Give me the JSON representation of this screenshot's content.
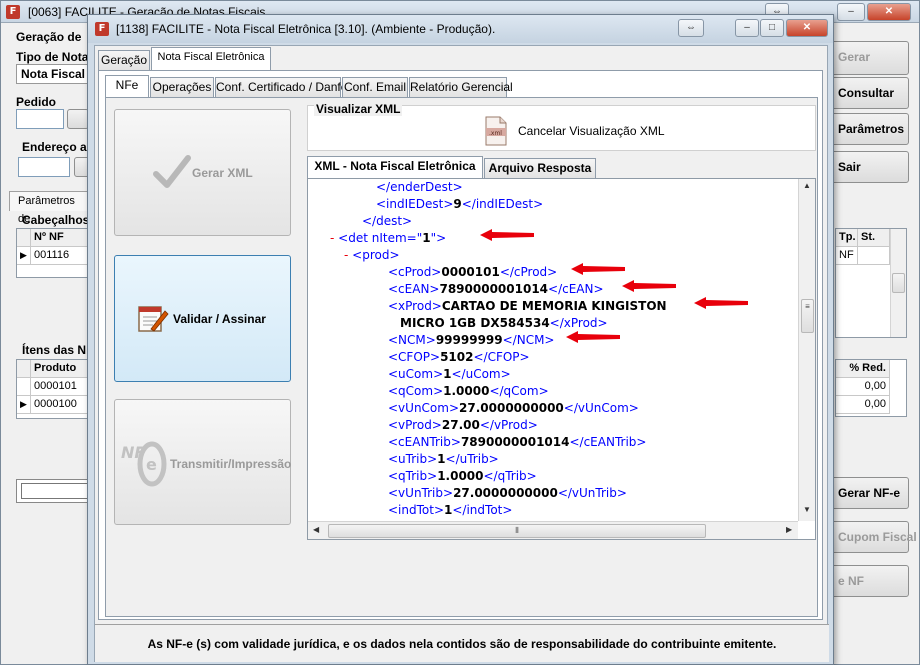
{
  "back_window": {
    "title": "[0063] FACILITE - Geração de Notas Fiscais",
    "labels": {
      "geracao_de": "Geração de",
      "tipo_de_nota": "Tipo de Nota",
      "nota_fiscal": "Nota Fiscal",
      "pedido": "Pedido",
      "endereco": "Endereço a",
      "parametros": "Parâmetros de",
      "cabecalhos": "Cabeçalhos",
      "itens": "Ítens das N"
    },
    "buttons": [
      "Gerar",
      "Consultar",
      "Parâmetros",
      "Sair",
      "Gerar NF-e",
      "Cupom Fiscal",
      "e NF"
    ],
    "header_grid": {
      "columns": [
        "Nº NF",
        "Tp.",
        "St."
      ],
      "rows": [
        {
          "nf": "001116",
          "tp": "NF",
          "st": ""
        }
      ]
    },
    "items_grid": {
      "columns": [
        "Produto",
        "% Red."
      ],
      "rows": [
        {
          "produto": "0000101",
          "red": "0,00"
        },
        {
          "produto": "0000100",
          "red": "0,00"
        }
      ]
    }
  },
  "dialog": {
    "title": "[1138] FACILITE - Nota Fiscal Eletrônica [3.10]. (Ambiente - Produção).",
    "top_tabs": [
      "Geração",
      "Nota Fiscal Eletrônica"
    ],
    "sub_tabs": [
      "NFe",
      "Operações",
      "Conf. Certificado / Danfe",
      "Conf. Email",
      "Relatório Gerencial"
    ],
    "buttons": {
      "gerar_xml": "Gerar XML",
      "validar": "Validar / Assinar",
      "transmitir": "Transmitir/Impressão"
    },
    "group_title": "Visualizar XML",
    "cancel_view": "Cancelar Visualização XML",
    "viewer_tabs": [
      "XML - Nota Fiscal Eletrônica",
      "Arquivo Resposta"
    ],
    "xml_lines": [
      {
        "tag": "</enderDest>"
      },
      {
        "open": "<indIEDest>",
        "val": "9",
        "close": "</indIEDest>"
      },
      {
        "tag": "</dest>"
      },
      {
        "mark": "-",
        "open": "<det nItem=\"",
        "val": "1",
        "close": "\">"
      },
      {
        "mark": "-",
        "tag": "<prod>"
      },
      {
        "open": "<cProd>",
        "val": "0000101",
        "close": "</cProd>"
      },
      {
        "open": "<cEAN>",
        "val": "7890000001014",
        "close": "</cEAN>"
      },
      {
        "open": "<xProd>",
        "val": "CARTAO DE MEMORIA KINGISTON"
      },
      {
        "val": "MICRO 1GB DX584534",
        "close": "</xProd>"
      },
      {
        "open": "<NCM>",
        "val": "99999999",
        "close": "</NCM>"
      },
      {
        "open": "<CFOP>",
        "val": "5102",
        "close": "</CFOP>"
      },
      {
        "open": "<uCom>",
        "val": "1",
        "close": "</uCom>"
      },
      {
        "open": "<qCom>",
        "val": "1.0000",
        "close": "</qCom>"
      },
      {
        "open": "<vUnCom>",
        "val": "27.0000000000",
        "close": "</vUnCom>"
      },
      {
        "open": "<vProd>",
        "val": "27.00",
        "close": "</vProd>"
      },
      {
        "open": "<cEANTrib>",
        "val": "7890000001014",
        "close": "</cEANTrib>"
      },
      {
        "open": "<uTrib>",
        "val": "1",
        "close": "</uTrib>"
      },
      {
        "open": "<qTrib>",
        "val": "1.0000",
        "close": "</qTrib>"
      },
      {
        "open": "<vUnTrib>",
        "val": "27.0000000000",
        "close": "</vUnTrib>"
      },
      {
        "open": "<indTot>",
        "val": "1",
        "close": "</indTot>"
      }
    ],
    "footer": "As NF-e (s) com validade jurídica, e os dados nela contidos são de responsabilidade do contribuinte emitente."
  },
  "colors": {
    "xml_tag": "#0000ff",
    "annotation_arrow": "#e8000b",
    "focus_border": "#3c7fb1"
  }
}
